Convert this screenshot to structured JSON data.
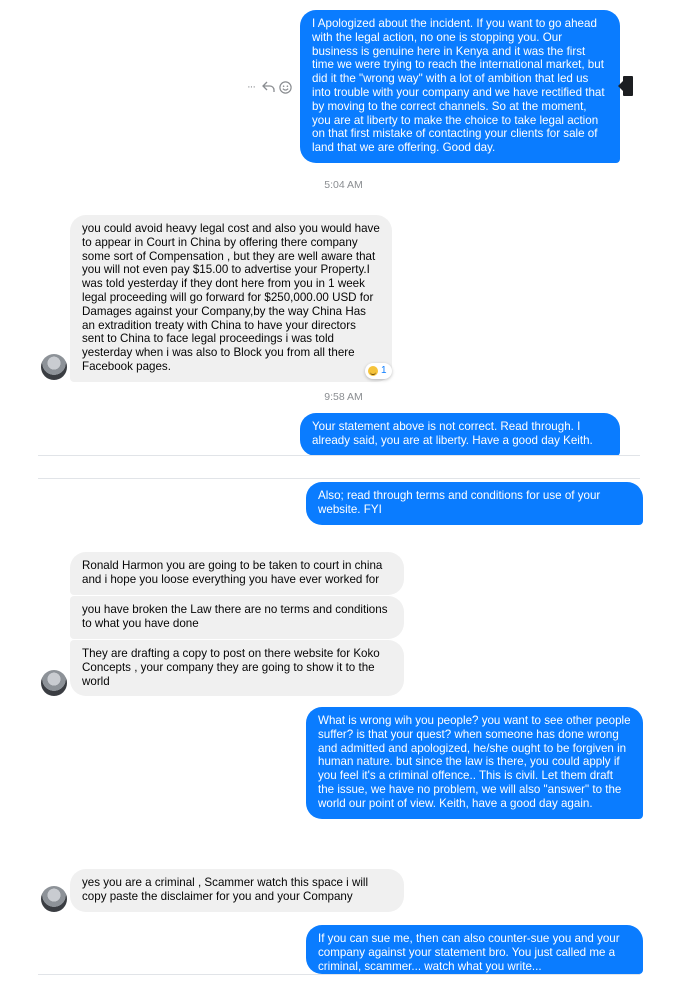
{
  "messages": {
    "m1": "I Apologized about the incident. If you want to go ahead with the legal action, no one is stopping you. Our business is genuine here in Kenya and it was the first time we were trying to reach the international market, but did it the \"wrong way\" with a lot of ambition that led us into trouble with your company and we have rectified that by moving to the correct channels. So at the moment, you are at liberty to make the choice to take legal action on that first mistake of contacting your clients for sale of land that we are offering. Good day.",
    "m2": "you could avoid heavy legal cost and also you would have to appear in Court in China by offering there company some sort of Compensation , but they are well aware that you will not even pay $15.00 to advertise your Property.I was told yesterday if they dont here from you in 1 week legal proceeding will go forward for $250,000.00 USD for Damages against your Company,by the way China Has an extradition treaty with China to have your directors sent to China to face legal proceedings i was told yesterday when i was also to Block you from all there Facebook pages.",
    "m3": "Your statement above is not correct. Read through. I already said, you are at liberty. Have a good day Keith.",
    "m4": "Also; read through terms and conditions for use of your website. FYI",
    "m5": "Ronald Harmon you are going to be taken to court in china and i hope you loose everything you have ever worked for",
    "m6": "you have broken the Law there are no terms and conditions to what you have done",
    "m7": "They are drafting a copy to post on there website for Koko Concepts , your company they are going to show it to the world",
    "m8": "What is wrong wih you people? you want to see other people suffer? is that your quest? when someone has done wrong and admitted and apologized, he/she ought to be forgiven in human nature. but since the law is there, you could apply if you feel it's a criminal offence.. This is civil. Let them draft the issue, we have no problem, we will also \"answer\" to the world our point of view. Keith, have a good day again.",
    "m9": "yes you are a criminal , Scammer watch this space i will copy paste the disclaimer for you and your Company",
    "m10": "If you can sue me, then can also counter-sue you and your company against your statement bro. You just called me a criminal, scammer... watch what you write..."
  },
  "timestamps": {
    "t1": "5:04 AM",
    "t2": "9:58 AM"
  },
  "reaction": {
    "emoji": "grinning-face",
    "count": "1"
  },
  "actions": {
    "more": "···"
  },
  "colors": {
    "outgoing": "#0a7cff",
    "incoming": "#f0f0f0",
    "timestamp": "#8a8d91"
  }
}
